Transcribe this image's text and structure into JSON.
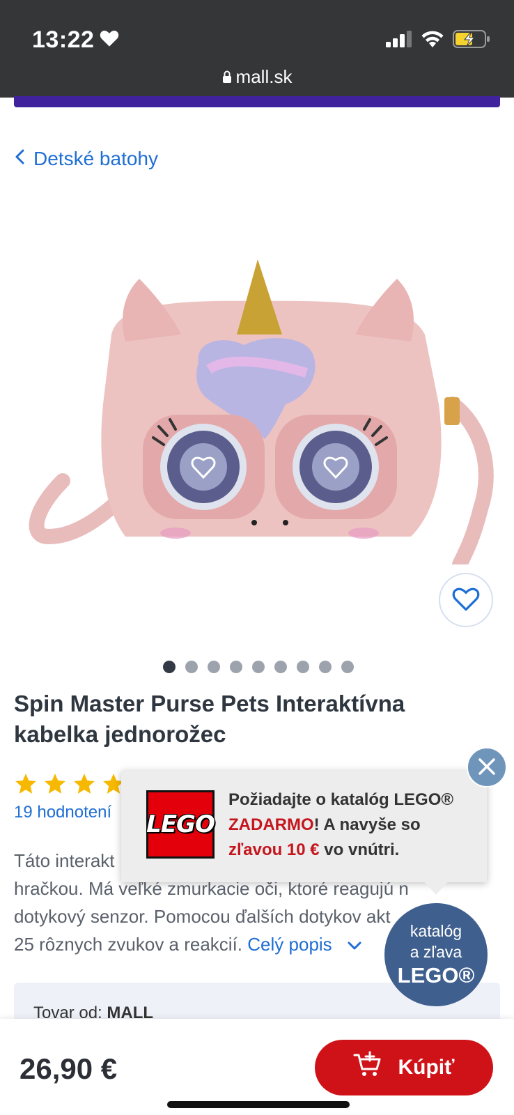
{
  "status_bar": {
    "time": "13:22",
    "url": "mall.sk"
  },
  "breadcrumb": {
    "label": "Detské batohy"
  },
  "gallery": {
    "dot_count": 9,
    "active_index": 0
  },
  "product": {
    "title": "Spin Master Purse Pets Interaktívna kabelka jednorožec",
    "rating_stars": 5,
    "reviews_label": "19 hodnotení",
    "description_lines": [
      "Táto interakt",
      "hračkou. Má veľké zmurkacie oči, ktoré reagujú n",
      "dotykový senzor. Pomocou ďalších dotykov akt",
      "25 rôznych zvukov a reakcií."
    ],
    "description_more": "Celý popis",
    "seller_label": "Tovar od:",
    "seller_name": "MALL"
  },
  "popup": {
    "logo_text": "LEGO",
    "line_a": "Požiadajte o katalóg LEGO®",
    "line_b_red": "ZADARMO",
    "line_b_rest": "! A navyše so",
    "line_c_red": "zľavou 10 €",
    "line_c_rest": " vo vnútri."
  },
  "catalog_bubble": {
    "line1": "katalóg",
    "line2": "a zľava",
    "line3": "LEGO®"
  },
  "bottom_bar": {
    "price": "26,90 €",
    "buy_label": "Kúpiť"
  },
  "colors": {
    "accent_blue": "#1f6ed4",
    "buy_red": "#cf1218",
    "purple": "#40239c"
  }
}
